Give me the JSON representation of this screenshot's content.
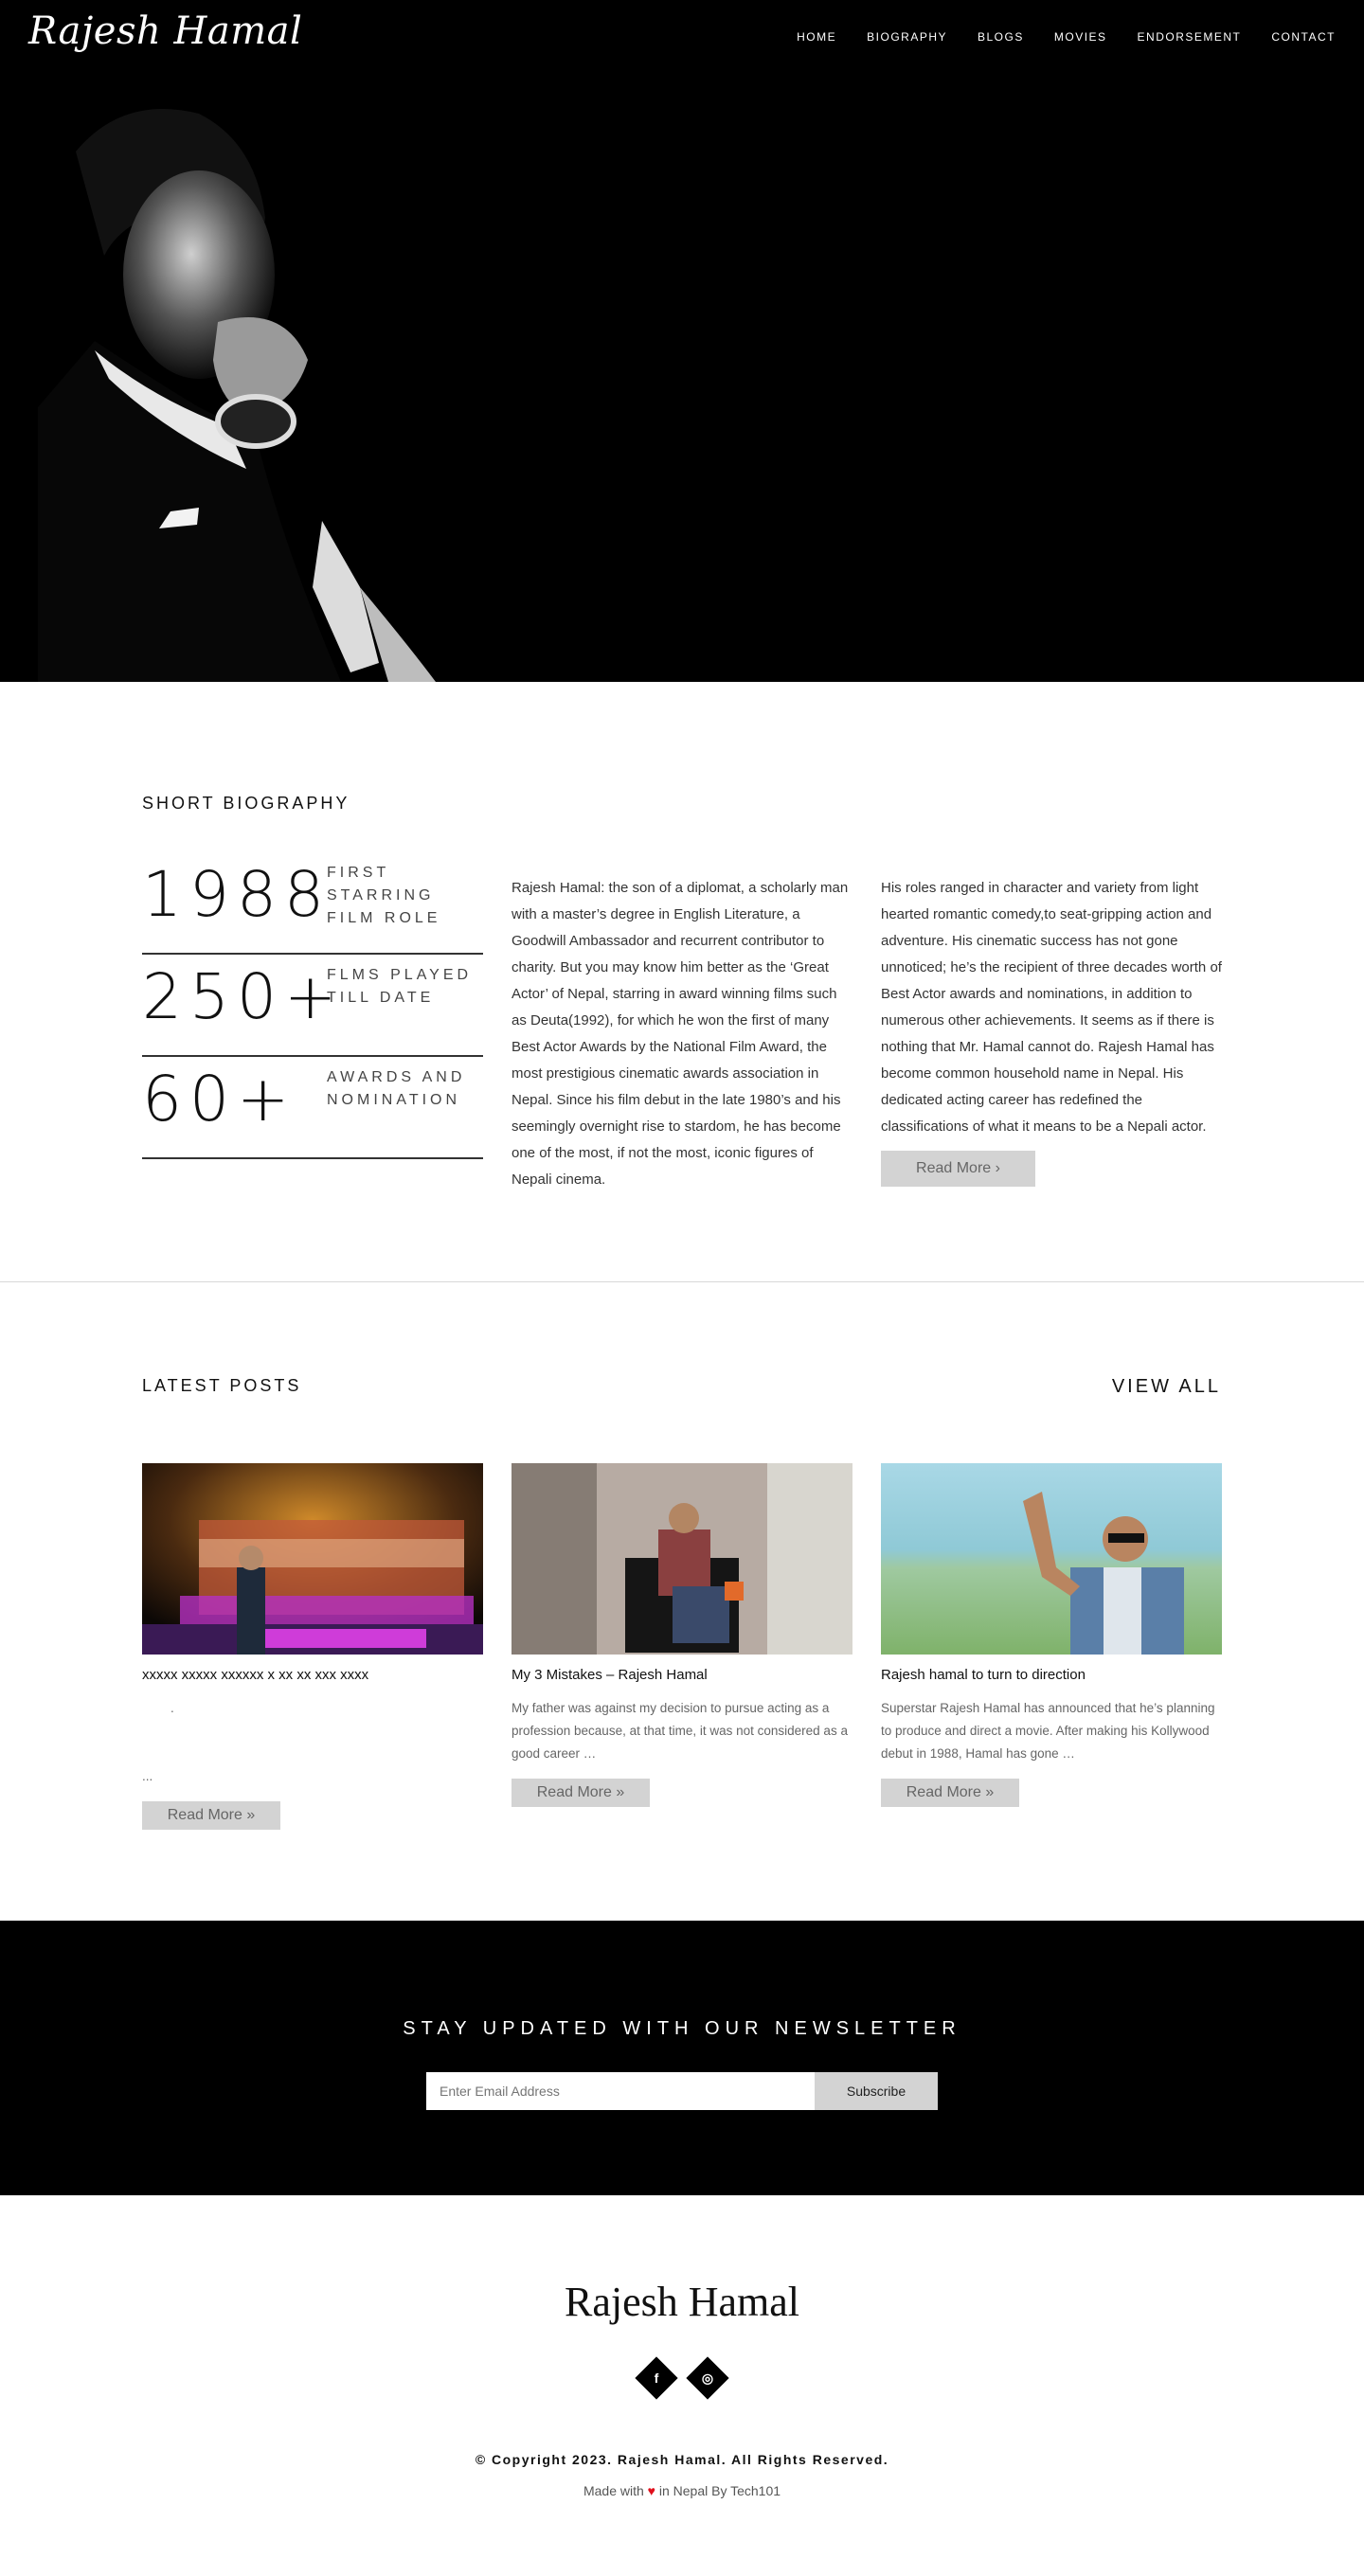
{
  "header": {
    "logo": "Rajesh Hamal",
    "nav": [
      "HOME",
      "BIOGRAPHY",
      "BLOGS",
      "MOVIES",
      "ENDORSEMENT",
      "CONTACT"
    ]
  },
  "bio": {
    "title": "SHORT BIOGRAPHY",
    "stats": [
      {
        "number": "1988",
        "label": "FIRST STARRING FILM ROLE"
      },
      {
        "number": "250+",
        "label": "FLMS PLAYED TILL DATE"
      },
      {
        "number": "60+",
        "label": "AWARDS AND NOMINATION"
      }
    ],
    "paragraph1": "Rajesh Hamal: the son of a diplomat, a scholarly man with a master’s degree in English Literature, a Goodwill Ambassador and recurrent contributor to charity. But you may know him better as the ‘Great Actor’ of Nepal, starring in award winning films such as Deuta(1992), for which he won the first of many Best Actor Awards by the National Film Award, the most prestigious cinematic awards association in Nepal. Since his film debut in the late 1980’s and his seemingly overnight rise to stardom, he has become one of the most, if not the most, iconic figures of Nepali cinema.",
    "paragraph2": "His roles ranged in character and variety from light hearted romantic comedy,to seat-gripping action and adventure. His cinematic success has not gone unnoticed; he’s the recipient of three decades worth of Best Actor awards and nominations, in addition to numerous other achievements. It seems as if there is nothing that Mr. Hamal cannot do. Rajesh Hamal has become common household name in Nepal. His dedicated acting career has redefined the classifications of what it means to be a Nepali actor.",
    "read_more": "Read More ›"
  },
  "posts": {
    "title": "LATEST POSTS",
    "view_all": "VIEW ALL",
    "items": [
      {
        "title": "xxxxx xxxxx xxxxxx x xx xx xxx xxxx",
        "excerpt_line1": ".",
        "excerpt_line2": "...",
        "read_more": "Read More »"
      },
      {
        "title": "My 3 Mistakes – Rajesh Hamal",
        "excerpt": "My father was against my decision to pursue acting as a profession because, at that time, it was not considered as a good career …",
        "read_more": "Read More »"
      },
      {
        "title": "Rajesh hamal to turn to direction",
        "excerpt": "Superstar Rajesh Hamal has announced that he’s planning to produce and direct a movie. After making his Kollywood debut in 1988, Hamal has gone …",
        "read_more": "Read More »"
      }
    ]
  },
  "newsletter": {
    "title": "STAY UPDATED WITH OUR NEWSLETTER",
    "placeholder": "Enter Email Address",
    "button": "Subscribe"
  },
  "footer": {
    "name": "Rajesh Hamal",
    "social": [
      {
        "icon": "facebook-icon",
        "glyph": "f"
      },
      {
        "icon": "instagram-icon",
        "glyph": "◎"
      }
    ],
    "copyright": "© Copyright 2023. Rajesh Hamal. All Rights Reserved.",
    "made_with_prefix": "Made with",
    "made_with_suffix": "in Nepal By Tech101"
  },
  "colors": {
    "hero_bg": "#000000",
    "button_grey": "#d3d3d3",
    "heart": "#e0101c"
  }
}
